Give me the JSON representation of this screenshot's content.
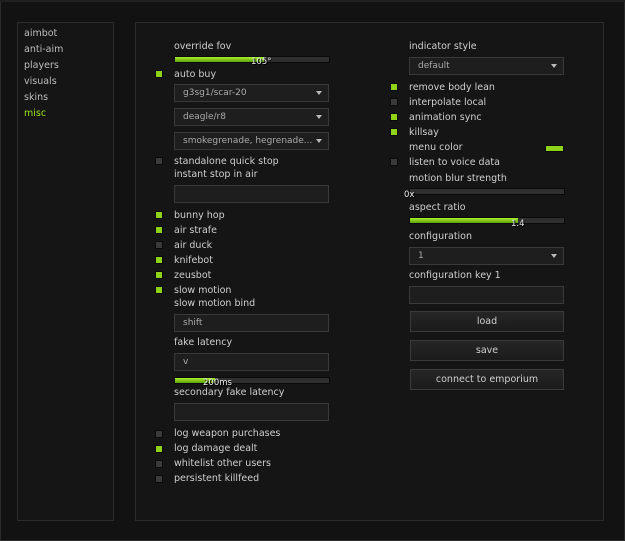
{
  "nav": [
    "aimbot",
    "anti-aim",
    "players",
    "visuals",
    "skins",
    "misc"
  ],
  "left": {
    "override_fov": {
      "label": "override fov",
      "value": "105°",
      "fill": 0.58
    },
    "auto_buy": {
      "label": "auto buy",
      "checked": true
    },
    "primary": "g3sg1/scar-20",
    "secondary": "deagle/r8",
    "utility": "smokegrenade, hegrenade...",
    "standalone_quick_stop": {
      "label": "standalone quick stop",
      "checked": false
    },
    "instant_stop": "instant stop in air",
    "bunny_hop": {
      "label": "bunny hop",
      "checked": true
    },
    "air_strafe": {
      "label": "air strafe",
      "checked": true
    },
    "air_duck": {
      "label": "air duck",
      "checked": false
    },
    "knifebot": {
      "label": "knifebot",
      "checked": true
    },
    "zeusbot": {
      "label": "zeusbot",
      "checked": true
    },
    "slow_motion": {
      "label": "slow motion",
      "checked": true
    },
    "slow_motion_bind": {
      "label": "slow motion bind",
      "value": "shift"
    },
    "fake_latency": {
      "label": "fake latency",
      "key": "v",
      "value": "200ms",
      "fill": 0.26
    },
    "secondary_fake_latency": "secondary fake latency",
    "log_weapon_purchases": {
      "label": "log weapon purchases",
      "checked": false
    },
    "log_damage_dealt": {
      "label": "log damage dealt",
      "checked": true
    },
    "whitelist_other_users": {
      "label": "whitelist other users",
      "checked": false
    },
    "persistent_killfeed": {
      "label": "persistent killfeed",
      "checked": false
    }
  },
  "right": {
    "indicator_style": {
      "label": "indicator style",
      "value": "default"
    },
    "remove_body_lean": {
      "label": "remove body lean",
      "checked": true
    },
    "interpolate_local": {
      "label": "interpolate local",
      "checked": false
    },
    "animation_sync": {
      "label": "animation sync",
      "checked": true
    },
    "killsay": {
      "label": "killsay",
      "checked": true
    },
    "menu_color": {
      "label": "menu color",
      "color": "#8fd21a"
    },
    "listen_to_voice_data": {
      "label": "listen to voice data",
      "checked": false
    },
    "motion_blur_strength": {
      "label": "motion blur strength",
      "value": "0x",
      "fill": 0
    },
    "aspect_ratio": {
      "label": "aspect ratio",
      "value": "1.4",
      "fill": 0.7
    },
    "configuration": {
      "label": "configuration",
      "value": "1"
    },
    "configuration_key": "configuration key 1",
    "load": "load",
    "save": "save",
    "connect": "connect to emporium"
  },
  "colors": {
    "accent": "#8fd21a",
    "panel": "#151515",
    "border": "#2c2c2c"
  }
}
